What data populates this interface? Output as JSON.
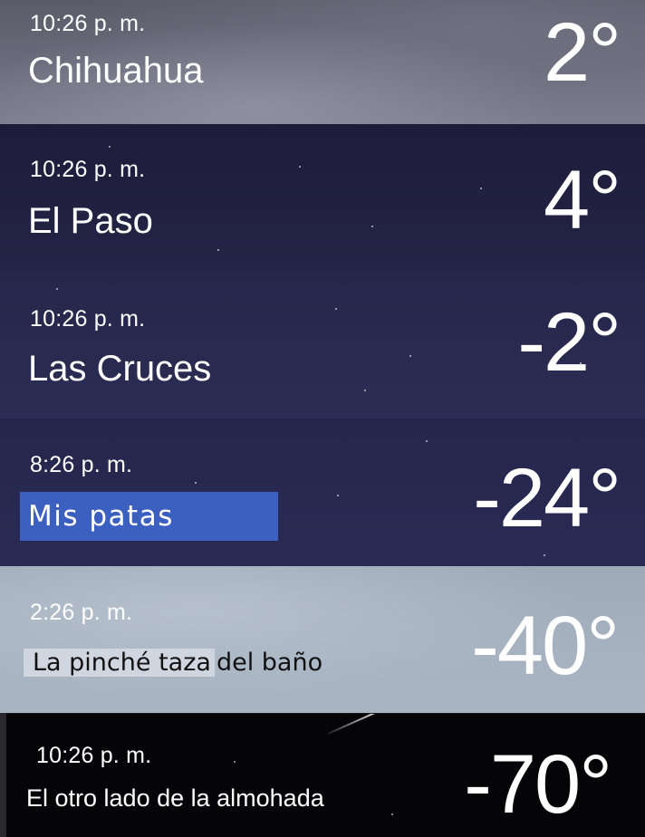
{
  "locations": [
    {
      "time": "10:26 p. m.",
      "name": "Chihuahua",
      "temp": "2°"
    },
    {
      "time": "10:26 p. m.",
      "name": "El Paso",
      "temp": "4°"
    },
    {
      "time": "10:26 p. m.",
      "name": "Las Cruces",
      "temp": "-2°"
    },
    {
      "time": "8:26 p. m.",
      "name": "Mis patas",
      "temp": "-24°"
    },
    {
      "time": "2:26 p. m.",
      "name_highlighted": "La pinché taza",
      "name_rest": "del baño",
      "temp": "-40°"
    },
    {
      "time": "10:26 p. m.",
      "name": "El otro lado de la almohada",
      "temp": "-70°"
    }
  ],
  "colors": {
    "cloudy_row": "#6c6d7c",
    "night_row": "#242446",
    "label_chip": "#3c60c0",
    "day_row": "#a6b2c0",
    "black_row": "#050507"
  }
}
